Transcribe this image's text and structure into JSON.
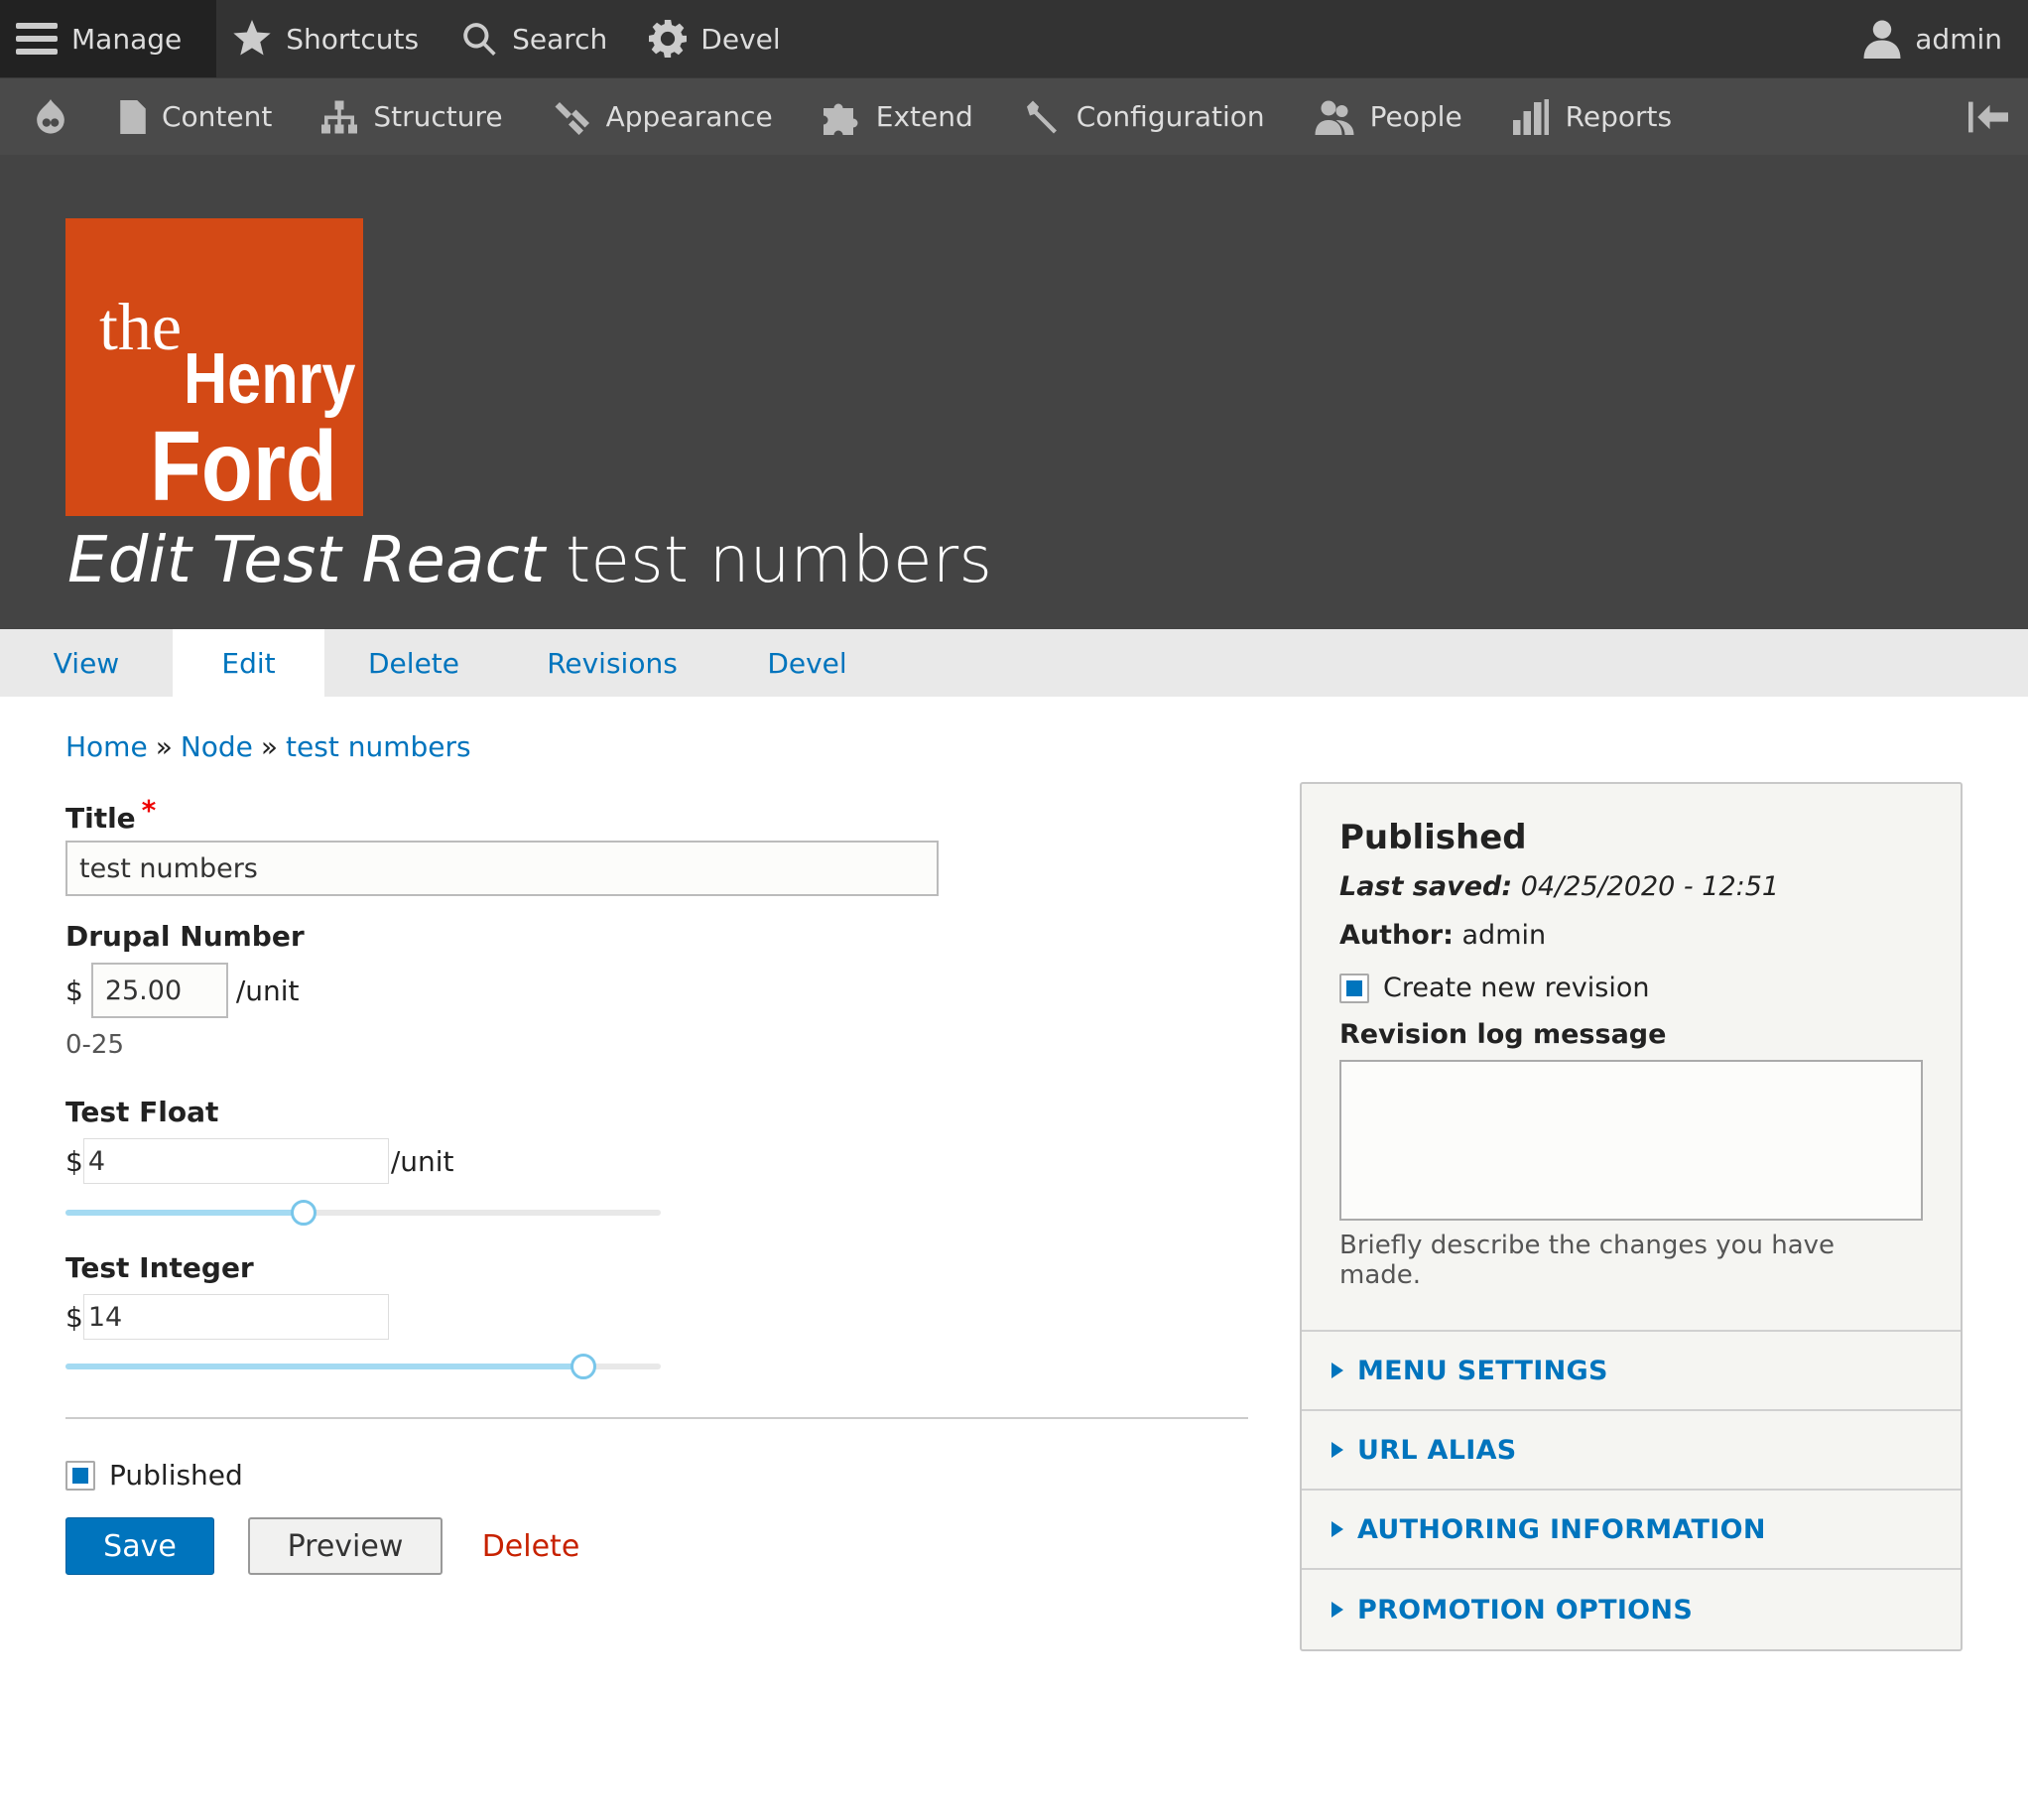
{
  "toolbar": {
    "manage": "Manage",
    "shortcuts": "Shortcuts",
    "search": "Search",
    "devel": "Devel",
    "user": "admin"
  },
  "tray": {
    "items": [
      "Content",
      "Structure",
      "Appearance",
      "Extend",
      "Configuration",
      "People",
      "Reports"
    ]
  },
  "header": {
    "logo_text": [
      "the",
      "Henry",
      "Ford"
    ],
    "title_italic": "Edit Test React",
    "title_rest": "test numbers"
  },
  "tabs": [
    "View",
    "Edit",
    "Delete",
    "Revisions",
    "Devel"
  ],
  "tabs_active": "Edit",
  "breadcrumb": {
    "items": [
      "Home",
      "Node",
      "test numbers"
    ],
    "separator": "»"
  },
  "form": {
    "title_label": "Title",
    "required_mark": "*",
    "title_value": "test numbers",
    "drupal_number": {
      "label": "Drupal Number",
      "prefix": "$",
      "value": "25.00",
      "suffix": "/unit",
      "description": "0-25"
    },
    "test_float": {
      "label": "Test Float",
      "prefix": "$",
      "value": "4",
      "suffix": "/unit",
      "slider_fraction": 0.4
    },
    "test_integer": {
      "label": "Test Integer",
      "prefix": "$",
      "value": "14",
      "slider_fraction": 0.87
    },
    "published_label": "Published",
    "save": "Save",
    "preview": "Preview",
    "delete": "Delete"
  },
  "sidebar": {
    "status": "Published",
    "last_saved_label": "Last saved:",
    "last_saved_value": "04/25/2020 - 12:51",
    "author_label": "Author:",
    "author_value": "admin",
    "new_revision_label": "Create new revision",
    "revision_log_label": "Revision log message",
    "revision_log_description": "Briefly describe the changes you have made.",
    "sections": [
      "MENU SETTINGS",
      "URL ALIAS",
      "AUTHORING INFORMATION",
      "PROMOTION OPTIONS"
    ]
  },
  "colors": {
    "toolbar": "#333333",
    "tray": "#4a4a4a",
    "header": "#444444",
    "link": "#0074bd",
    "logo": "#d34915",
    "danger": "#c72100"
  }
}
